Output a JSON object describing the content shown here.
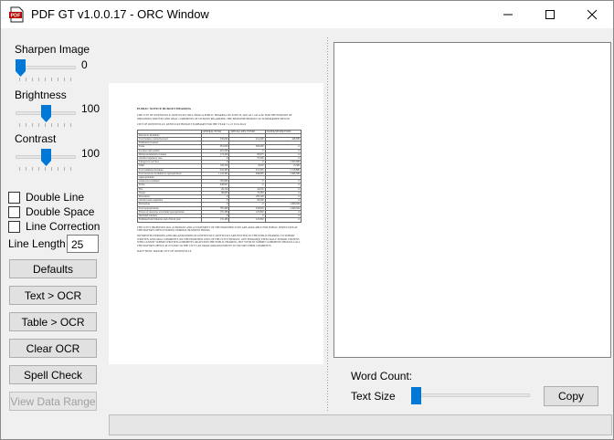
{
  "window": {
    "title": "PDF GT v1.0.0.17 - ORC Window",
    "icon_text": "PDF"
  },
  "controls": {
    "sharpen": {
      "label": "Sharpen Image",
      "value": "0",
      "level": 0.0
    },
    "brightness": {
      "label": "Brightness",
      "value": "100",
      "level": 0.5
    },
    "contrast": {
      "label": "Contrast",
      "value": "100",
      "level": 0.5
    },
    "checkboxes": [
      {
        "label": "Double Line",
        "checked": false
      },
      {
        "label": "Double Space",
        "checked": false
      },
      {
        "label": "Line Correction",
        "checked": false
      }
    ],
    "line_length": {
      "label": "Line Length",
      "value": "25"
    }
  },
  "buttons": {
    "defaults": "Defaults",
    "text_ocr": "Text > OCR",
    "table_ocr": "Table > OCR",
    "clear_ocr": "Clear OCR",
    "spell_check": "Spell Check",
    "view_data_range": "View Data Range",
    "copy": "Copy"
  },
  "right_panel": {
    "word_count_label": "Word Count:",
    "text_size_label": "Text Size",
    "text_size_level": 0.0
  },
  "document": {
    "heading": "PUBLIC NOTICE BUDGET HEARING",
    "intro": "THE CITY OF OWENSVILLE, KENTUCKY WILL HOLD A PUBLIC HEARING ON JUNE 18, 2021 AT 11:45 A.M. FOR THE PURPOSE OF OBTAINING WRITTEN AND ORAL COMMENTS OF CITIZENS REGARDING THE PROPOSED BUDGET AS SUMMARIZED BELOW",
    "subhead": "CITY OF OWENSVILLE, KENTUCKY BUDGET SUMMARY FOR THE YEAR 7-1-21 TO 6-30-22",
    "columns": [
      "",
      "GENERAL FUND",
      "SPECIAL REV. FUNDS",
      "WATER/SEWER FUND"
    ],
    "rows": [
      [
        "Resources Available:",
        "",
        "",
        ""
      ],
      [
        "Total balance carried forward",
        "330,000",
        "214,200",
        "448,580"
      ],
      [
        "Estimated revenues:",
        "",
        "",
        ""
      ],
      [
        "Taxes",
        "381,000",
        "300,000",
        "-0"
      ],
      [
        "Licenses and permits",
        "261,500",
        "-0",
        "-0"
      ],
      [
        "Intergovernmental revenues",
        "173,436",
        "83,975",
        "-0"
      ],
      [
        "Alcohol regulatory fees",
        "-0",
        "35,500",
        "-0"
      ],
      [
        "Charges for services",
        "-0",
        "-0",
        "1,503,580"
      ],
      [
        "Other",
        "126,529",
        "8,020",
        "15,300"
      ],
      [
        "Total estimated revenues",
        "942,465",
        "212,395",
        "1,518,880"
      ],
      [
        "Total resources available for appropriations",
        "1,142,465",
        "468,895",
        "1,966,580"
      ],
      [
        "Appropriations:",
        "",
        "",
        ""
      ],
      [
        "General Government",
        "285,896",
        "-0",
        "-0"
      ],
      [
        "Police",
        "648,827",
        "-0",
        "-0"
      ],
      [
        "Fire",
        "49,156",
        "44,050",
        "-0"
      ],
      [
        "Streets",
        "80,000",
        "76,383",
        "-0"
      ],
      [
        "Recreation",
        "-0",
        "185,548",
        "-0"
      ],
      [
        "Alcohol sales regulation",
        "-0",
        "30,000",
        "-0"
      ],
      [
        "Enterprises",
        "-0",
        "-0",
        "1,966,584"
      ],
      [
        "Total appropriations",
        "787,499",
        "343,093",
        "1,966,584"
      ],
      [
        "Excess of resources over/under appropriations",
        "155,186",
        "125,802",
        "-0"
      ],
      [
        "Interfund transfers",
        "-0",
        "-0",
        "-0"
      ],
      [
        "Estimated fund balances end of fiscal year",
        "155,186",
        "125,802",
        "-0"
      ]
    ],
    "para1": "THE CITY'S PROPOSED 2021-22 BUDGET AND A STATEMENT OF THE PROPOSED USES ARE AVAILABLE FOR PUBLIC INSPECTION AT THE MAYOR'S OFFICE DURING NORMAL BUSINESS HOURS.",
    "para2": "INTERESTED PERSONS AND ORGANIZATIONS IN OWENSVILLE, KENTUCKY ARE INVITED TO THE PUBLIC HEARING TO SUBMIT WRITTEN AND ORAL COMMENTS ON THE PROPOSED USES OF THE CITY'S BUDGET. ANY PERSON(S) ESPECIALLY SENIOR CITIZENS WHO CANNOT SUBMIT WRITTEN COMMENTS OR ATTEND THE PUBLIC HEARING, BUT WISH TO SUBMIT COMMENTS SHOULD CALL THE MAYOR'S OFFICE AT 674-6362 SO THE CITY CAN MAKE ARRANGEMENTS TO SECURE THEIR COMMENTS.",
    "signature": "DAVY HUNT, MAYOR CITY OF OWENSVILLE"
  },
  "colors": {
    "accent": "#0078d7",
    "window_bg": "#f0f0f0",
    "button_bg": "#e1e1e1",
    "disabled_text": "#a0a0a0"
  }
}
